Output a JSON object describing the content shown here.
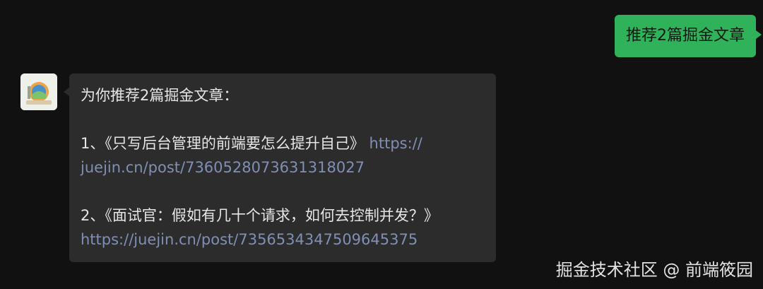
{
  "outgoing_message": {
    "text": "推荐2篇掘金文章"
  },
  "incoming_message": {
    "intro": "为你推荐2篇掘金文章：",
    "articles": [
      {
        "prefix": "1、《只写后台管理的前端要怎么提升自己》 ",
        "link_part1": "https://",
        "link_part2": "juejin.cn/post/7360528073631318027"
      },
      {
        "prefix": "2、《面试官：假如有几十个请求，如何去控制并发？》",
        "link": "https://juejin.cn/post/7356534347509645375"
      }
    ]
  },
  "watermark": {
    "text": "掘金技术社区 @ 前端筱园"
  },
  "colors": {
    "background": "#111111",
    "outgoing_bubble": "#2fb25a",
    "incoming_bubble": "#2c2c2c",
    "link": "#7f8fb5"
  },
  "icons": {
    "avatar": "bot-avatar-icon"
  }
}
